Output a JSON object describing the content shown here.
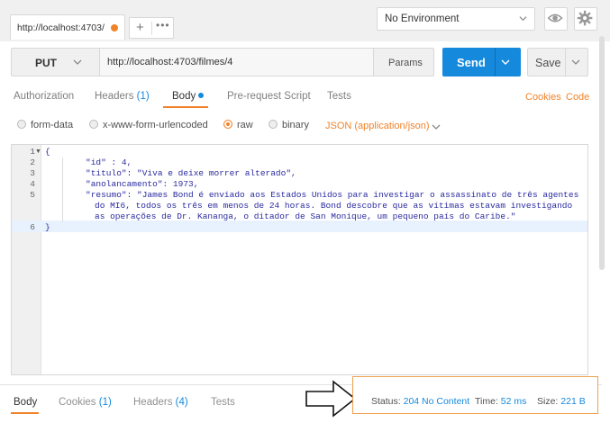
{
  "tabs": {
    "active_tab": {
      "label": "http://localhost:4703/",
      "status_color": "#f0832a"
    },
    "new_tab_icon": "plus-icon",
    "more_icon": "ellipsis-icon"
  },
  "environment": {
    "selected": "No Environment",
    "eye_icon": "eye-icon",
    "settings_icon": "gear-icon"
  },
  "request": {
    "method": "PUT",
    "url": "http://localhost:4703/filmes/4",
    "params_label": "Params",
    "send_label": "Send",
    "save_label": "Save"
  },
  "request_tabs": {
    "authorization": "Authorization",
    "headers": "Headers",
    "headers_count": "(1)",
    "body": "Body",
    "pre_request": "Pre-request Script",
    "tests": "Tests",
    "cookies_link": "Cookies",
    "code_link": "Code"
  },
  "body_modes": {
    "form_data": "form-data",
    "urlencoded": "x-www-form-urlencoded",
    "raw": "raw",
    "binary": "binary",
    "selected": "raw",
    "content_type": "JSON (application/json)"
  },
  "editor": {
    "lines": [
      {
        "n": "1",
        "text": "{"
      },
      {
        "n": "2",
        "text": "\"id\" : 4,"
      },
      {
        "n": "3",
        "text": "\"titulo\": \"Viva e deixe morrer alterado\","
      },
      {
        "n": "4",
        "text": "\"anolancamento\": 1973,"
      },
      {
        "n": "5",
        "text": "\"resumo\": \"James Bond é enviado aos Estados Unidos para investigar o assassinato de três agentes"
      },
      {
        "n": "",
        "text": "do MI6, todos os três em menos de 24 horas. Bond descobre que as vítimas estavam investigando"
      },
      {
        "n": "",
        "text": "as operações de Dr. Kananga, o ditador de San Monique, um pequeno país do Caribe.\""
      },
      {
        "n": "6",
        "text": "}"
      }
    ]
  },
  "response_tabs": {
    "body": "Body",
    "cookies": "Cookies",
    "cookies_count": "(1)",
    "headers": "Headers",
    "headers_count": "(4)",
    "tests": "Tests"
  },
  "response_status": {
    "status_label": "Status:",
    "status_value": "204 No Content",
    "time_label": "Time:",
    "time_value": "52 ms",
    "size_label": "Size:",
    "size_value": "221 B"
  },
  "colors": {
    "accent": "#f0832a",
    "primary": "#1589dc"
  }
}
